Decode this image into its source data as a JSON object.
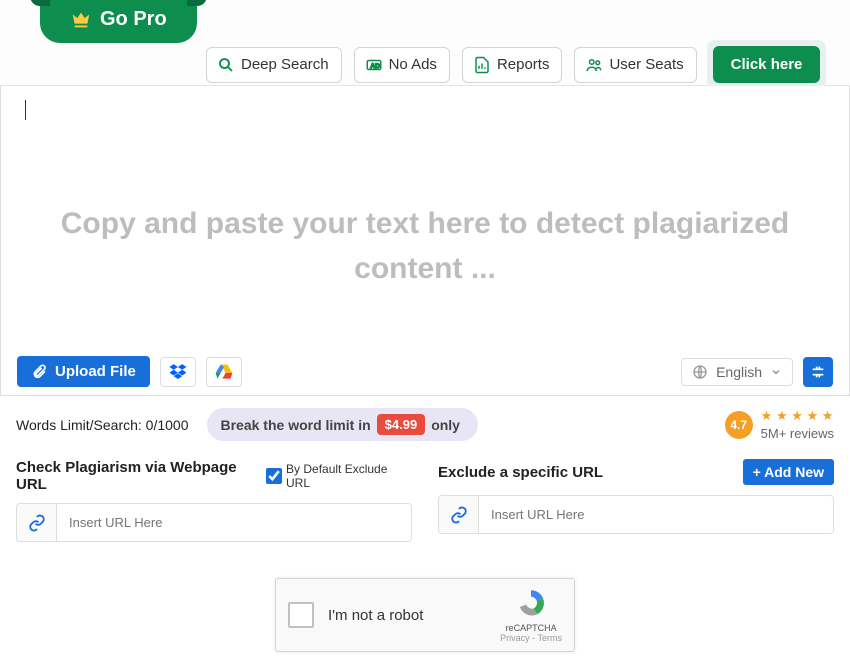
{
  "topbar": {
    "go_pro": "Go Pro",
    "features": {
      "deep_search": "Deep Search",
      "no_ads": "No Ads",
      "reports": "Reports",
      "user_seats": "User Seats"
    },
    "click_here": "Click here"
  },
  "text_area": {
    "placeholder": "Copy and paste your text here to detect plagiarized content ..."
  },
  "toolbar": {
    "upload_label": "Upload File",
    "language": "English"
  },
  "info": {
    "words_limit": "Words Limit/Search: 0/1000",
    "break_limit_pre": "Break the word limit in",
    "price": "$4.99",
    "break_limit_post": "only",
    "rating_value": "4.7",
    "reviews": "5M+ reviews"
  },
  "url_section": {
    "check_title": "Check Plagiarism via Webpage URL",
    "exclude_checkbox_label": "By Default Exclude URL",
    "exclude_title": "Exclude a specific URL",
    "add_new": "+ Add New",
    "url_placeholder": "Insert URL Here"
  },
  "captcha": {
    "label": "I'm not a robot",
    "brand": "reCAPTCHA",
    "privacy": "Privacy - Terms"
  },
  "colors": {
    "primary_green": "#0d8e4f",
    "primary_blue": "#186fd9",
    "accent_red": "#e74c3c",
    "accent_orange": "#f59f24"
  }
}
